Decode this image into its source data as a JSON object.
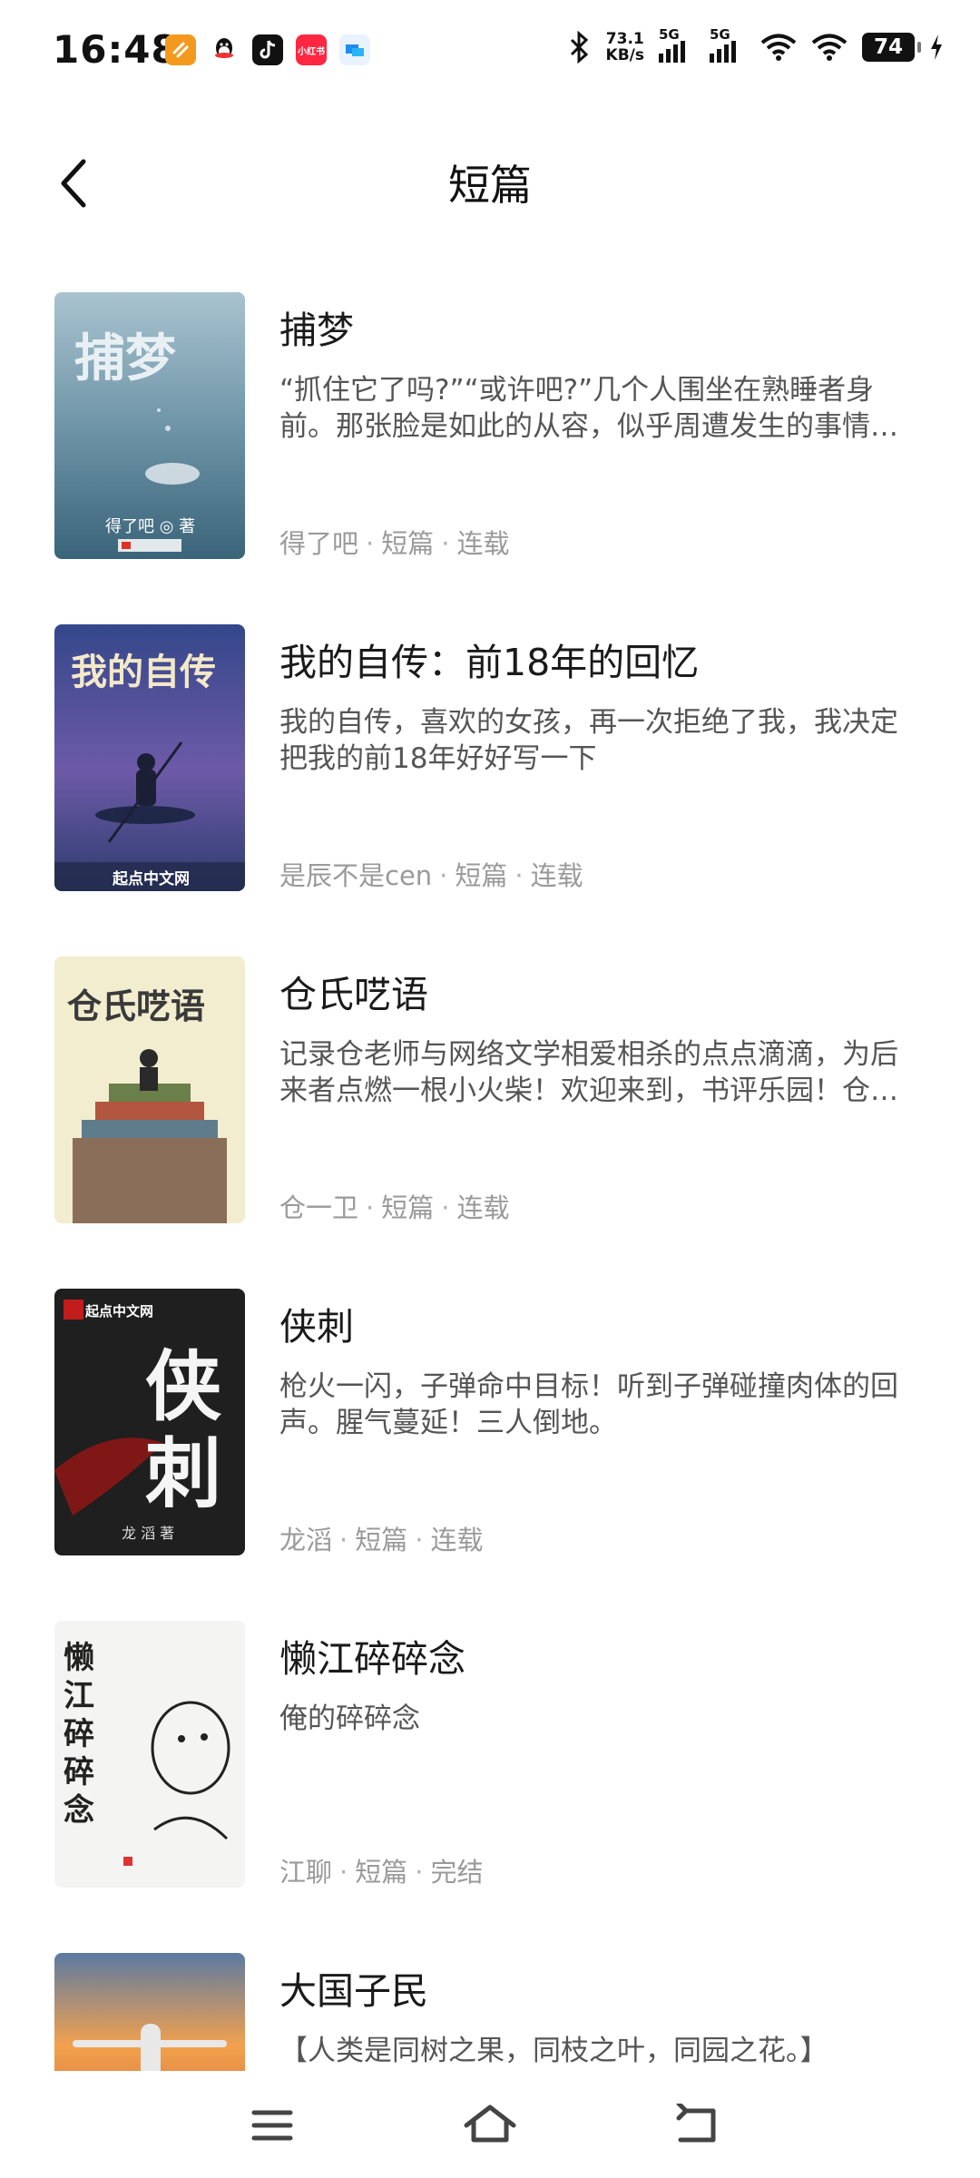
{
  "status": {
    "time": "16:48",
    "speed_value": "73.1",
    "speed_unit": "KB/s",
    "net1": "5G",
    "net2": "5G",
    "battery": "74",
    "app_icons": [
      "app-icon-orange",
      "qq-icon",
      "tiktok-icon",
      "xiaohongshu-icon",
      "app-icon-blue"
    ],
    "xhs_label": "小红书"
  },
  "header": {
    "title": "短篇",
    "back_icon": "chevron-left-icon"
  },
  "books": [
    {
      "title": "捕梦",
      "desc": "“抓住它了吗?”“或许吧?”几个人围坐在熟睡者身前。那张脸是如此的从容，似乎周遭发生的事情…",
      "author": "得了吧",
      "category": "短篇",
      "status": "连载",
      "cover_text": "捕梦",
      "cover_author": "得了吧 ◎ 著",
      "cover_colors": [
        "#9fbac6",
        "#3f6c82"
      ]
    },
    {
      "title": "我的自传：前18年的回忆",
      "desc": "我的自传，喜欢的女孩，再一次拒绝了我，我决定把我的前18年好好写一下",
      "author": "是辰不是cen",
      "category": "短篇",
      "status": "连载",
      "cover_text": "我的自传",
      "cover_publisher": "起点中文网",
      "cover_colors": [
        "#3c4f8e",
        "#8a5aa8"
      ]
    },
    {
      "title": "仓氏呓语",
      "desc": "记录仓老师与网络文学相爱相杀的点点滴滴，为后来者点燃一根小火柴！欢迎来到，书评乐园！仓…",
      "author": "仓一卫",
      "category": "短篇",
      "status": "连载",
      "cover_text": "仓氏呓语",
      "cover_colors": [
        "#f3efd4",
        "#d9c78e"
      ]
    },
    {
      "title": "侠刺",
      "desc": "枪火一闪，子弹命中目标！听到子弹碰撞肉体的回声。腥气蔓延！三人倒地。",
      "author": "龙滔",
      "category": "短篇",
      "status": "连载",
      "cover_text": "侠刺",
      "cover_publisher": "起点中文网",
      "cover_author": "龙 滔  著",
      "cover_colors": [
        "#1e1e1e",
        "#3a3a3a"
      ]
    },
    {
      "title": "懒江碎碎念",
      "desc": "俺的碎碎念",
      "author": "江聊",
      "category": "短篇",
      "status": "完结",
      "cover_text": "懒江碎碎念",
      "cover_colors": [
        "#f4f4f2",
        "#ebebe8"
      ]
    },
    {
      "title": "大国子民",
      "desc": "【人类是同树之果，同枝之叶，同园之花。】",
      "author": "",
      "category": "",
      "status": "",
      "cover_text": "",
      "cover_colors": [
        "#f2a552",
        "#5e7fa6"
      ]
    }
  ],
  "separator": "·",
  "navbar": {
    "menu_icon": "menu-icon",
    "home_icon": "home-icon",
    "back_icon": "back-icon"
  }
}
